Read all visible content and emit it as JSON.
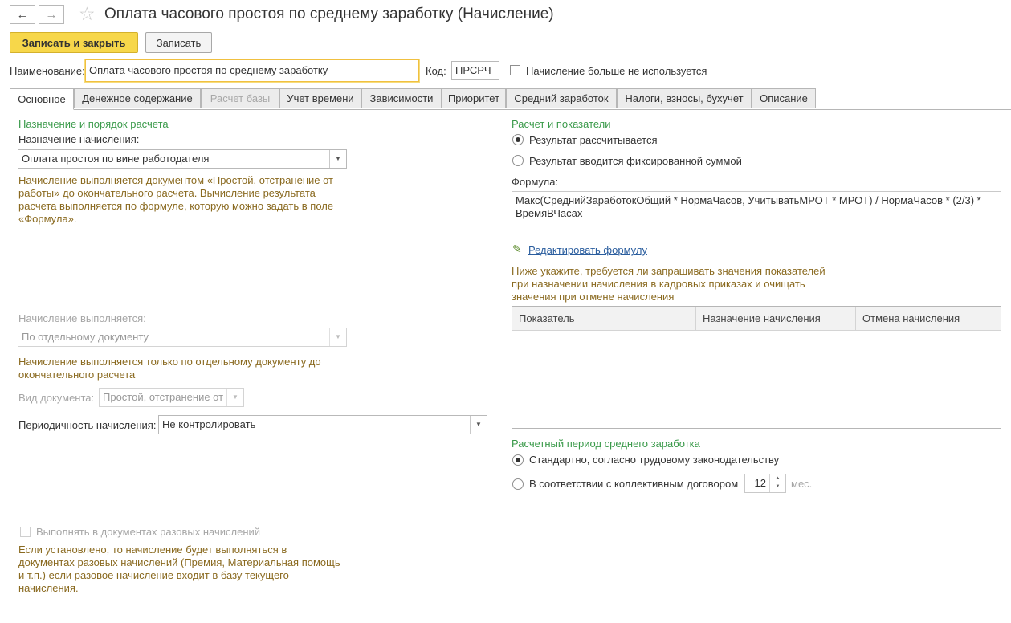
{
  "window": {
    "title": "Оплата часового простоя по среднему заработку (Начисление)",
    "back_icon": "←",
    "forward_icon": "→",
    "star_icon": "☆"
  },
  "toolbar": {
    "save_close_label": "Записать и закрыть",
    "save_label": "Записать"
  },
  "header": {
    "name_label": "Наименование:",
    "name_value": "Оплата часового простоя по среднему заработку",
    "code_label": "Код:",
    "code_value": "ПРСРЧ",
    "unused_label": "Начисление больше не используется"
  },
  "tabs": [
    {
      "label": "Основное"
    },
    {
      "label": "Денежное содержание"
    },
    {
      "label": "Расчет базы"
    },
    {
      "label": "Учет времени"
    },
    {
      "label": "Зависимости"
    },
    {
      "label": "Приоритет"
    },
    {
      "label": "Средний заработок"
    },
    {
      "label": "Налоги, взносы, бухучет"
    },
    {
      "label": "Описание"
    }
  ],
  "left": {
    "section_title": "Назначение и порядок расчета",
    "purpose_label": "Назначение начисления:",
    "purpose_value": "Оплата простоя по вине работодателя",
    "purpose_hint": [
      "Начисление выполняется документом «Простой, отстранение от",
      "работы» до окончательного расчета. Вычисление результата",
      "расчета выполняется по формуле, которую можно задать в поле",
      "«Формула»."
    ],
    "executed_label": "Начисление выполняется:",
    "executed_value": "По отдельному документу",
    "executed_hint": [
      "Начисление выполняется только по отдельному документу до",
      "окончательного расчета"
    ],
    "doc_kind_label": "Вид документа:",
    "doc_kind_value": "Простой, отстранение от р",
    "periodicity_label": "Периодичность начисления:",
    "periodicity_value": "Не контролировать",
    "one_time_label": "Выполнять в документах разовых начислений",
    "one_time_hint": [
      "Если установлено, то начисление будет выполняться в",
      "документах разовых начислений (Премия, Материальная помощь",
      "и т.п.) если разовое начисление входит в базу текущего",
      "начисления."
    ]
  },
  "right": {
    "section_title": "Расчет и показатели",
    "radio_calculated": "Результат рассчитывается",
    "radio_fixed": "Результат вводится фиксированной суммой",
    "formula_label": "Формула:",
    "formula_line1": "Макс(СреднийЗаработокОбщий * НормаЧасов, УчитыватьМРОТ * МРОТ) / НормаЧасов * (2/3) *",
    "formula_line2": "ВремяВЧасах",
    "edit_formula_link": "Редактировать формулу",
    "indicators_hint": [
      "Ниже укажите, требуется ли запрашивать значения показателей",
      "при назначении начисления в кадровых приказах и очищать",
      "значения при отмене начисления"
    ],
    "table_columns": [
      "Показатель",
      "Назначение начисления",
      "Отмена начисления"
    ],
    "period_title": "Расчетный период среднего заработка",
    "radio_standard": "Стандартно, согласно трудовому законодательству",
    "radio_collective": "В соответствии с коллективным договором",
    "months_value": "12",
    "months_unit": "мес."
  }
}
